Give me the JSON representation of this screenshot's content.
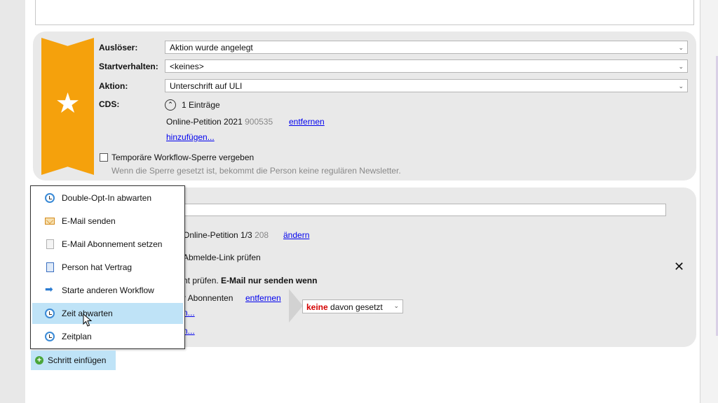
{
  "trigger_panel": {
    "trigger_label": "Auslöser:",
    "trigger_value": "Aktion wurde angelegt",
    "start_label": "Startverhalten:",
    "start_value": "<keines>",
    "action_label": "Aktion:",
    "action_value": "Unterschrift auf ULI",
    "cds_label": "CDS:",
    "cds_count": "1 Einträge",
    "cds_entry_name": "Online-Petition 2021",
    "cds_entry_id": "900535",
    "cds_remove_link": "entfernen",
    "cds_add_link": "hinzufügen...",
    "lock_checkbox_label": "Temporäre Workflow-Sperre vergeben",
    "lock_hint": "Wenn die Sperre gesetzt ist, bekommt die Person keine regulären Newsletter."
  },
  "step_panel": {
    "petition_text": "Online-Petition 1/3",
    "petition_id": "208",
    "change_link": "ändern",
    "unsubscribe_text": "Abmelde-Link prüfen",
    "check_text": "nt prüfen.",
    "check_bold": "E-Mail nur senden wenn",
    "subscribers_text": "r Abonnenten",
    "remove_link": "entfernen",
    "partial_link_1": "n...",
    "partial_link_2": "n...",
    "condition_none": "keine",
    "condition_rest": "davon gesetzt",
    "close_symbol": "✕"
  },
  "menu": {
    "items": [
      {
        "label": "Double-Opt-In abwarten",
        "icon": "clock-icon"
      },
      {
        "label": "E-Mail senden",
        "icon": "mail-icon"
      },
      {
        "label": "E-Mail Abonnement setzen",
        "icon": "document-icon"
      },
      {
        "label": "Person hat Vertrag",
        "icon": "contract-icon"
      },
      {
        "label": "Starte anderen Workflow",
        "icon": "arrow-right-icon"
      },
      {
        "label": "Zeit abwarten",
        "icon": "clock-icon"
      },
      {
        "label": "Zeitplan",
        "icon": "clock-icon"
      }
    ],
    "hovered_index": 5
  },
  "insert_step_button": "Schritt einfügen",
  "colors": {
    "ribbon": "#f5a10c",
    "link": "#0000ee",
    "menu_hover": "#bfe3f7",
    "condition_red": "#d40000"
  }
}
